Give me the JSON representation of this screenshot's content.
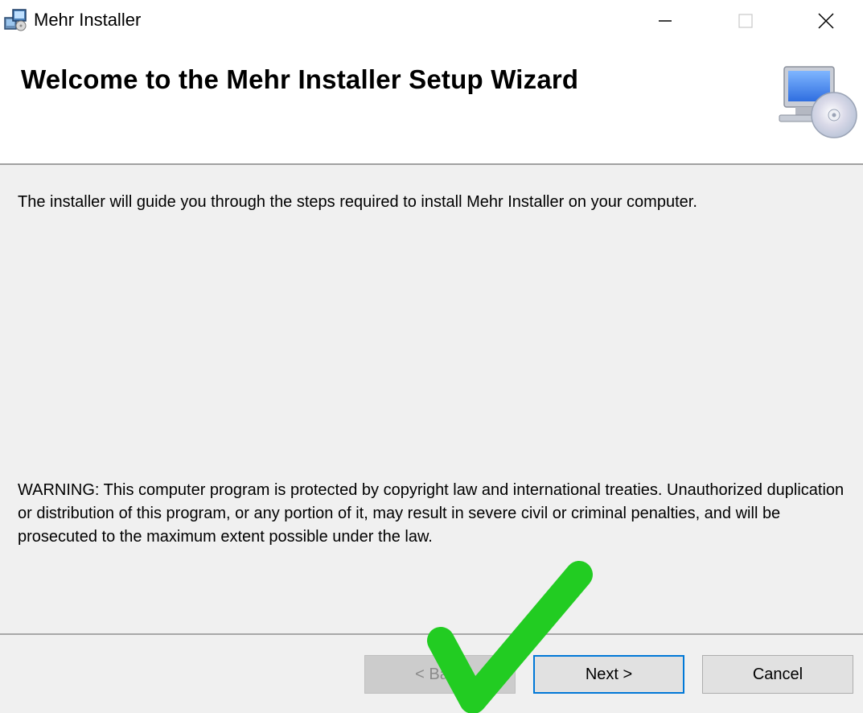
{
  "window": {
    "title": "Mehr Installer",
    "icon": "installer-app-icon",
    "controls": {
      "minimize": "minimize-icon",
      "maximize": "maximize-icon",
      "close": "close-icon"
    }
  },
  "banner": {
    "title": "Welcome to the Mehr Installer Setup Wizard",
    "art": "computer-cd-icon"
  },
  "body": {
    "intro": "The installer will guide you through the steps required to install Mehr Installer on your computer.",
    "warning": "WARNING: This computer program is protected by copyright law and international treaties. Unauthorized duplication or distribution of this program, or any portion of it, may result in severe civil or criminal penalties, and will be prosecuted to the maximum extent possible under the law."
  },
  "footer": {
    "back_label": "< Back",
    "next_label": "Next >",
    "cancel_label": "Cancel"
  },
  "overlay": {
    "icon": "green-checkmark-icon",
    "color": "#22cc22"
  },
  "colors": {
    "focus_border": "#0078d7",
    "background": "#f0f0f0"
  }
}
